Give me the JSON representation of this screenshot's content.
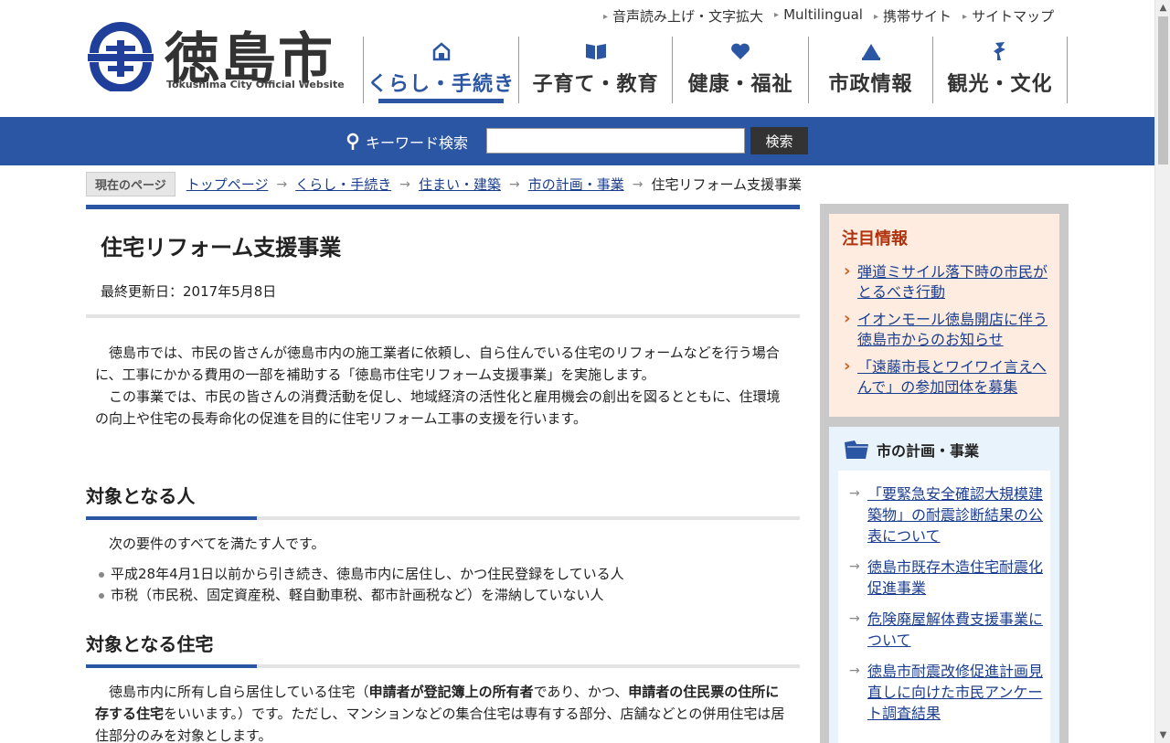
{
  "header": {
    "logo_text": "徳島市",
    "logo_subtitle": "Tokushima City Official Website",
    "utility_links": [
      "音声読み上げ・文字拡大",
      "Multilingual",
      "携帯サイト",
      "サイトマップ"
    ],
    "global_nav": [
      {
        "label": "くらし・手続き",
        "icon": "house-icon",
        "active": true
      },
      {
        "label": "子育て・教育",
        "icon": "book-icon",
        "active": false
      },
      {
        "label": "健康・福祉",
        "icon": "heart-icon",
        "active": false
      },
      {
        "label": "市政情報",
        "icon": "flag-icon",
        "active": false
      },
      {
        "label": "観光・文化",
        "icon": "dancer-icon",
        "active": false
      }
    ]
  },
  "search": {
    "label": "キーワード検索",
    "value": "",
    "button_label": "検索"
  },
  "breadcrumb": {
    "here_label": "現在のページ",
    "items": [
      "トップページ",
      "くらし・手続き",
      "住まい・建築",
      "市の計画・事業"
    ],
    "current": "住宅リフォーム支援事業"
  },
  "main": {
    "title": "住宅リフォーム支援事業",
    "updated": "最終更新日：2017年5月8日",
    "intro_1": "徳島市では、市民の皆さんが徳島市内の施工業者に依頼し、自ら住んでいる住宅のリフォームなどを行う場合に、工事にかかる費用の一部を補助する「徳島市住宅リフォーム支援事業」を実施します。",
    "intro_2": "この事業では、市民の皆さんの消費活動を促し、地域経済の活性化と雇用機会の創出を図るとともに、住環境の向上や住宅の長寿命化の促進を目的に住宅リフォーム工事の支援を行います。",
    "section1": {
      "heading": "対象となる人",
      "lead": "次の要件のすべてを満たす人です。",
      "items": [
        "平成28年4月1日以前から引き続き、徳島市内に居住し、かつ住民登録をしている人",
        "市税（市民税、固定資産税、軽自動車税、都市計画税など）を滞納していない人"
      ]
    },
    "section2": {
      "heading": "対象となる住宅",
      "text_a": "徳島市内に所有し自ら居住している住宅（",
      "bold_1": "申請者が登記簿上の所有者",
      "text_b": "であり、かつ、",
      "bold_2": "申請者の住民票の住所に存する住宅",
      "text_c": "をいいます。）です。ただし、マンションなどの集合住宅は専有する部分、店舗などとの併用住宅は居住部分のみを対象とします。"
    }
  },
  "sidebar": {
    "notice": {
      "title": "注目情報",
      "items": [
        "弾道ミサイル落下時の市民がとるべき行動",
        "イオンモール徳島開店に伴う徳島市からのお知らせ",
        "「遠藤市長とワイワイ言えへんで」の参加団体を募集"
      ]
    },
    "related": {
      "title": "市の計画・事業",
      "items": [
        "「要緊急安全確認大規模建築物」の耐震診断結果の公表について",
        "徳島市既存木造住宅耐震化促進事業",
        "危険廃屋解体費支援事業について",
        "徳島市耐震改修促進計画見直しに向けた市民アンケート調査結果"
      ]
    }
  },
  "colors": {
    "brand_blue": "#2b56a4",
    "notice_bg": "#fdecdf",
    "notice_title": "#b0340f",
    "related_bg": "#e9f3fb"
  }
}
